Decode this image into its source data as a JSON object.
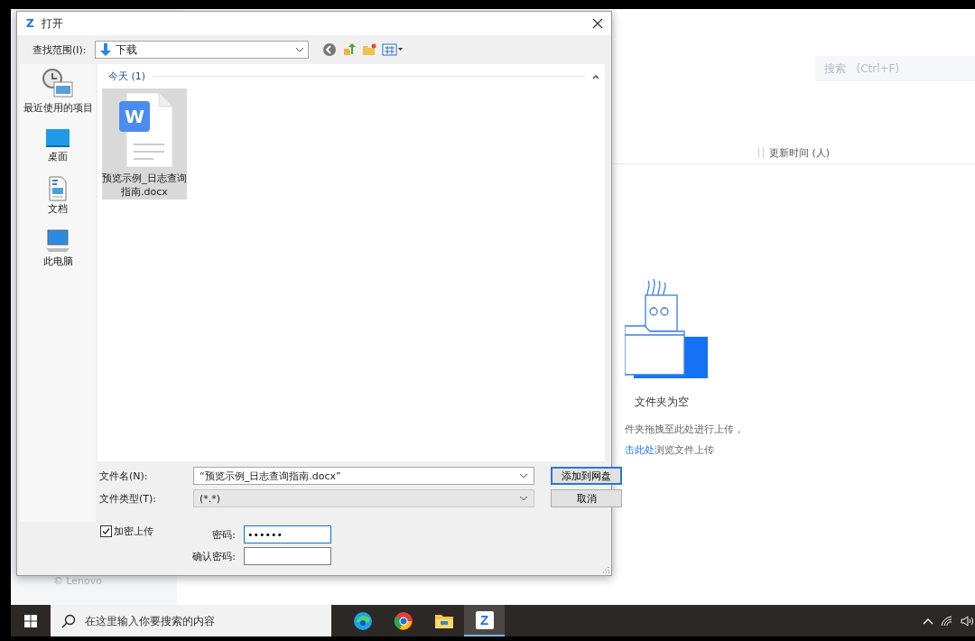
{
  "background_app": {
    "search": {
      "placeholder": "搜索   (Ctrl+F)"
    },
    "column_header": "更新时间 (人)",
    "empty_title": "文件夹为空",
    "drop_hint": "件夹拖拽至此处进行上传，",
    "browse_link": "击此处",
    "browse_text": "浏览文件上传",
    "footer": "© Lenovo"
  },
  "dialog": {
    "app_logo": "Z",
    "title": "打开",
    "look_in_label": "查找范围(I):",
    "look_in_value": "下载",
    "places": [
      {
        "label": "最近使用的项目",
        "kind": "recent"
      },
      {
        "label": "桌面",
        "kind": "desktop"
      },
      {
        "label": "文档",
        "kind": "documents"
      },
      {
        "label": "此电脑",
        "kind": "computer"
      }
    ],
    "group": {
      "label": "今天 (1)",
      "expanded": true
    },
    "files": [
      {
        "name": "预览示例_日志查询指南.docx",
        "icon_letter": "W",
        "selected": true
      }
    ],
    "filename_label": "文件名(N):",
    "filename_value": "“预览示例_日志查询指南.docx”",
    "filetype_label": "文件类型(T):",
    "filetype_value": "(*.*)",
    "buttons": [
      {
        "label": "添加到网盘",
        "kind": "default"
      },
      {
        "label": "取消",
        "kind": "normal"
      }
    ],
    "encrypt": {
      "label": "加密上传",
      "checked": true
    },
    "password_label": "密码:",
    "password_value": "••••••",
    "confirm_label": "确认密码:"
  },
  "taskbar": {
    "search_placeholder": "在这里输入你要搜索的内容",
    "apps": [
      {
        "kind": "edge",
        "selected": false
      },
      {
        "kind": "chrome",
        "selected": false
      },
      {
        "kind": "explorer",
        "selected": false
      },
      {
        "kind": "zapp",
        "letter": "Z",
        "selected": true
      }
    ]
  }
}
